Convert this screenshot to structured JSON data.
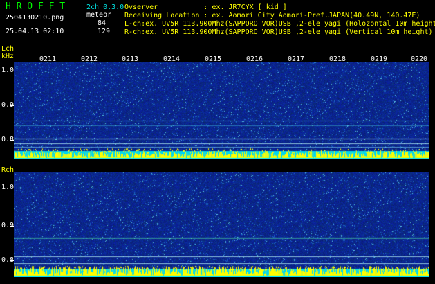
{
  "header": {
    "app_title": "H R O F F T",
    "filename": "2504130210.png",
    "datetime": "25.04.13 02:10",
    "version": "2ch 0.3.0",
    "meteor_label": "meteor",
    "meteor_l": "84",
    "meteor_r": "129"
  },
  "info": {
    "observer": "Ovserver           : ex. JR7CYX [ kid ]",
    "location": "Receiving Location : ex. Aomori City Aomori-Pref.JAPAN(40.49N, 140.47E)",
    "lch": "L-ch:ex. UV5R 113.900Mhz(SAPPORO VOR)USB ,2-ele yagi (Holozontal 10m height)",
    "rch": "R-ch:ex. UV5R 113.900Mhz(SAPPORO VOR)USB ,2-ele yagi (Vertical 10m height)"
  },
  "lch_panel": {
    "label": "Lch",
    "unit": "kHz",
    "time_labels": [
      "0211",
      "0212",
      "0213",
      "0214",
      "0215",
      "0216",
      "0217",
      "0218",
      "0219",
      "0220"
    ],
    "freq_labels": [
      "1.0",
      "0.9",
      "0.8"
    ]
  },
  "rch_panel": {
    "label": "Rch",
    "freq_labels": [
      "1.0",
      "0.9",
      "0.8"
    ]
  },
  "colors": {
    "background": "#000000",
    "waterfall_base": "#0a1e8c",
    "carrier_line": "#00e5e5",
    "meteor_trace": "#ffff00",
    "title": "#00ff00"
  }
}
